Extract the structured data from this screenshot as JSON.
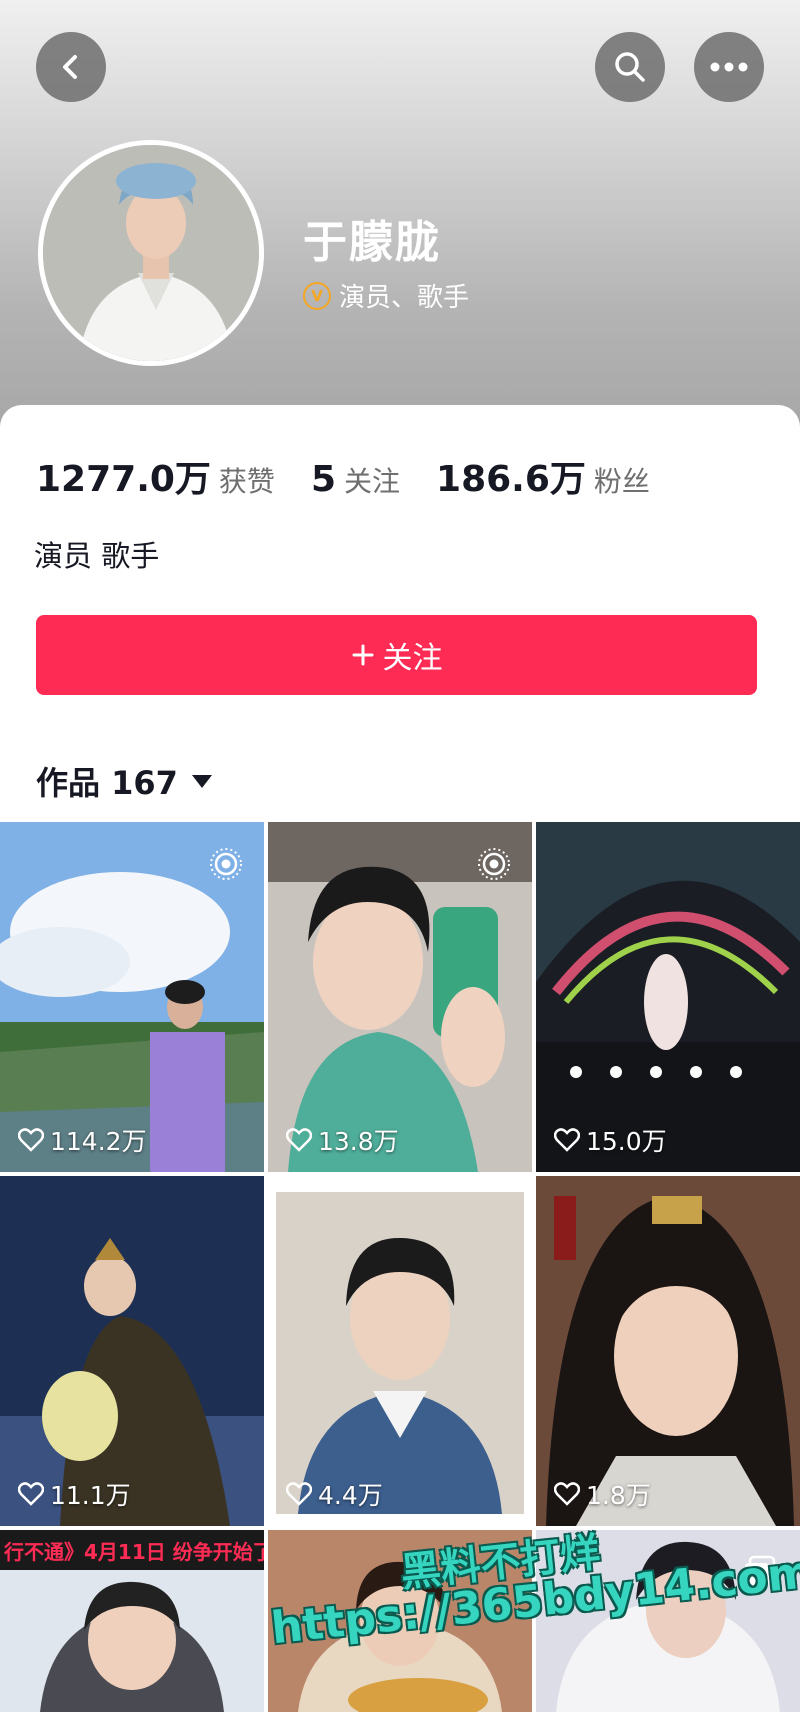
{
  "profile": {
    "nickname": "于朦胧",
    "verification": "演员、歌手",
    "verification_badge": "V",
    "bio": "演员 歌手"
  },
  "stats": [
    {
      "value": "1277.0万",
      "label": "获赞"
    },
    {
      "value": "5",
      "label": "关注"
    },
    {
      "value": "186.6万",
      "label": "粉丝"
    }
  ],
  "follow_button": {
    "icon": "plus-icon",
    "label": "关注"
  },
  "works": {
    "label": "作品 167"
  },
  "videos": [
    {
      "likes": "114.2万",
      "badge": "live-photo-icon"
    },
    {
      "likes": "13.8万",
      "badge": "live-photo-icon"
    },
    {
      "likes": "15.0万"
    },
    {
      "likes": "11.1万"
    },
    {
      "likes": "4.4万"
    },
    {
      "likes": "1.8万"
    },
    {
      "banner": "行不通》4月11日  纷争开始了"
    },
    {},
    {
      "badge": "multi-image-icon"
    }
  ],
  "watermark": {
    "line1": "黑料不打烊",
    "line2": "https://365bdy14.com"
  },
  "colors": {
    "accent": "#fe2c55",
    "verified": "#f5a623",
    "watermark": "#35d5c0"
  }
}
